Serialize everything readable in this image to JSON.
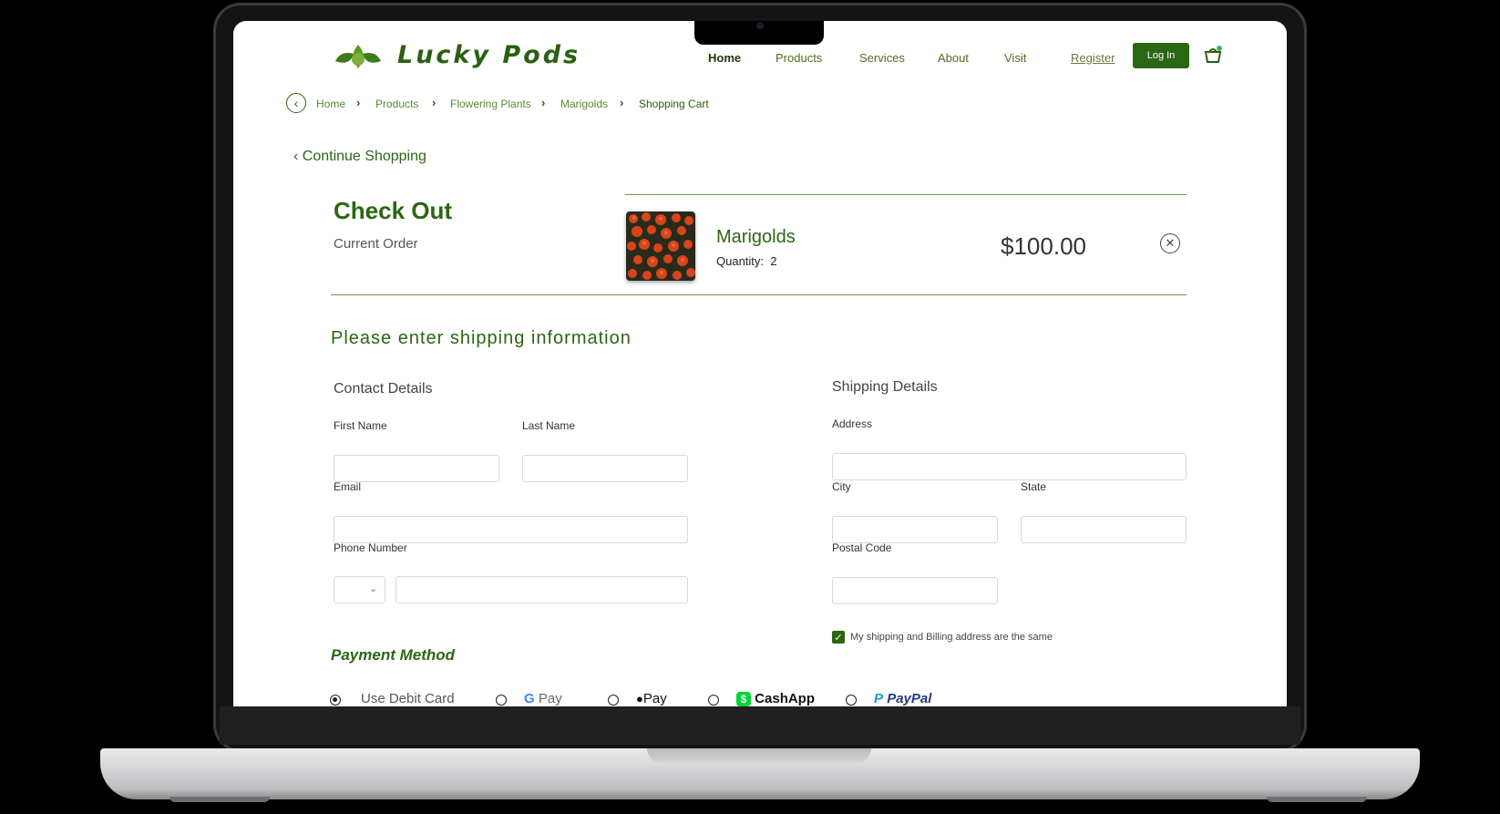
{
  "brand": {
    "name": "Lucky Pods",
    "accent": "#2b6712"
  },
  "nav": {
    "items": [
      "Home",
      "Products",
      "Services",
      "About",
      "Visit"
    ],
    "register": "Register",
    "login": "Log In"
  },
  "breadcrumb": [
    "Home",
    "Products",
    "Flowering Plants",
    "Marigolds",
    "Shopping Cart"
  ],
  "continue_shopping": "Continue Shopping",
  "checkout": {
    "title": "Check Out",
    "subtitle": "Current Order",
    "item": {
      "name": "Marigolds",
      "quantity_label": "Quantity:",
      "quantity": "2",
      "price": "$100.00"
    }
  },
  "shipping_heading": "Please enter shipping information",
  "contact": {
    "title": "Contact Details",
    "first_name": "First Name",
    "last_name": "Last Name",
    "email": "Email",
    "phone": "Phone Number"
  },
  "shipping": {
    "title": "Shipping Details",
    "address": "Address",
    "city": "City",
    "state": "State",
    "postal": "Postal Code",
    "same_address": "My shipping and Billing address are the same",
    "same_address_checked": true
  },
  "payment": {
    "title": "Payment Method",
    "options": [
      "Use Debit Card",
      "G Pay",
      "Pay",
      "CashApp",
      "PayPal"
    ],
    "selected": "Use Debit Card"
  }
}
